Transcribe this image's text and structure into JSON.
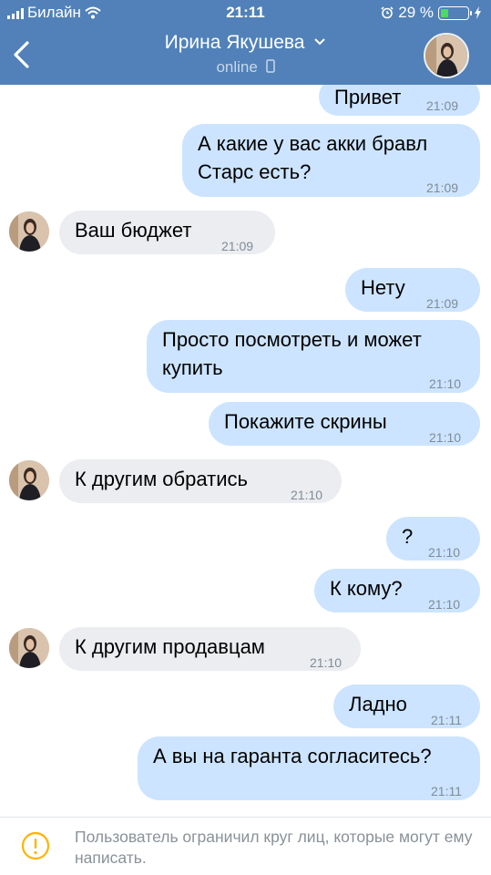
{
  "status_bar": {
    "carrier": "Билайн",
    "time": "21:11",
    "battery": "29 %",
    "battery_level": 0.29
  },
  "header": {
    "contact_name": "Ирина Якушева",
    "status": "online"
  },
  "messages": [
    {
      "dir": "out",
      "text": "Привет",
      "time": "21:09"
    },
    {
      "dir": "out",
      "line1": "А какие у вас акки бравл",
      "line2": "Старс есть?",
      "time": "21:09"
    },
    {
      "dir": "in",
      "text": "Ваш бюджет",
      "time": "21:09"
    },
    {
      "dir": "out",
      "text": "Нету",
      "time": "21:09"
    },
    {
      "dir": "out",
      "line1": "Просто посмотреть и может",
      "line2": "купить",
      "time": "21:10"
    },
    {
      "dir": "out",
      "text": "Покажите скрины",
      "time": "21:10"
    },
    {
      "dir": "in",
      "text": "К другим обратись",
      "time": "21:10"
    },
    {
      "dir": "out",
      "text": "?",
      "time": "21:10"
    },
    {
      "dir": "out",
      "text": "К кому?",
      "time": "21:10"
    },
    {
      "dir": "in",
      "text": "К другим продавцам",
      "time": "21:10"
    },
    {
      "dir": "out",
      "text": "Ладно",
      "time": "21:11"
    },
    {
      "dir": "out",
      "text": "А вы на гаранта согласитесь?",
      "time": "21:11"
    }
  ],
  "footer": {
    "notice": "Пользователь ограничил круг лиц, которые могут ему написать."
  }
}
